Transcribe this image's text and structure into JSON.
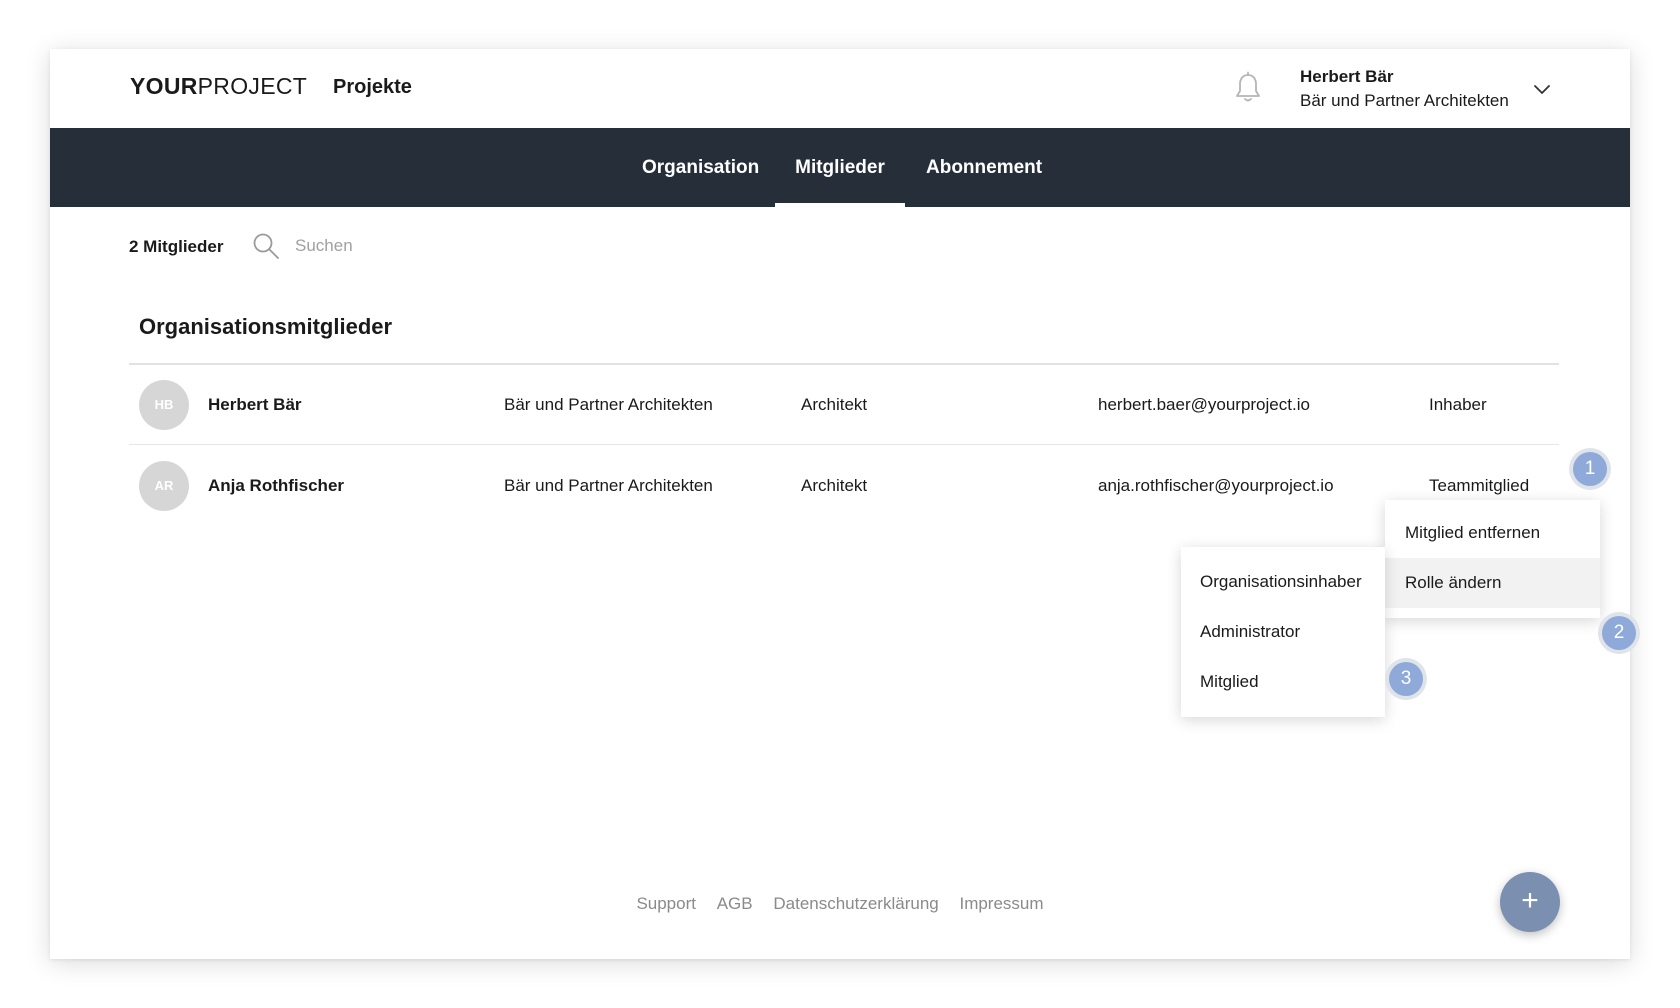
{
  "header": {
    "logo_strong": "YOUR",
    "logo_light": "PROJECT",
    "projects_link": "Projekte",
    "user_name": "Herbert Bär",
    "user_org": "Bär und Partner Architekten"
  },
  "nav": {
    "tabs": [
      {
        "label": "Organisation",
        "active": false
      },
      {
        "label": "Mitglieder",
        "active": true
      },
      {
        "label": "Abonnement",
        "active": false
      }
    ]
  },
  "toolbar": {
    "member_count": "2 Mitglieder",
    "search_placeholder": "Suchen"
  },
  "section": {
    "title": "Organisationsmitglieder"
  },
  "members": [
    {
      "initials": "HB",
      "name": "Herbert Bär",
      "organization": "Bär und Partner Architekten",
      "job": "Architekt",
      "email": "herbert.baer@yourproject.io",
      "role": "Inhaber"
    },
    {
      "initials": "AR",
      "name": "Anja Rothfischer",
      "organization": "Bär und Partner Architekten",
      "job": "Architekt",
      "email": "anja.rothfischer@yourproject.io",
      "role": "Teammitglied"
    }
  ],
  "context_menu": {
    "items": [
      "Mitglied entfernen",
      "Rolle ändern"
    ]
  },
  "role_menu": {
    "items": [
      "Organisationsinhaber",
      "Administrator",
      "Mitglied"
    ]
  },
  "step_badges": [
    "1",
    "2",
    "3"
  ],
  "footer": {
    "links": [
      "Support",
      "AGB",
      "Datenschutzerklärung",
      "Impressum"
    ]
  },
  "fab": {
    "label": "+"
  },
  "colors": {
    "navbar": "#262e3a",
    "badge": "#8fa9d8",
    "fab": "#7b8fb0",
    "avatar": "#d6d6d6"
  },
  "icons": {
    "bell": "bell-icon",
    "chevron": "chevron-down-icon",
    "search": "search-icon",
    "fab": "plus-icon"
  }
}
